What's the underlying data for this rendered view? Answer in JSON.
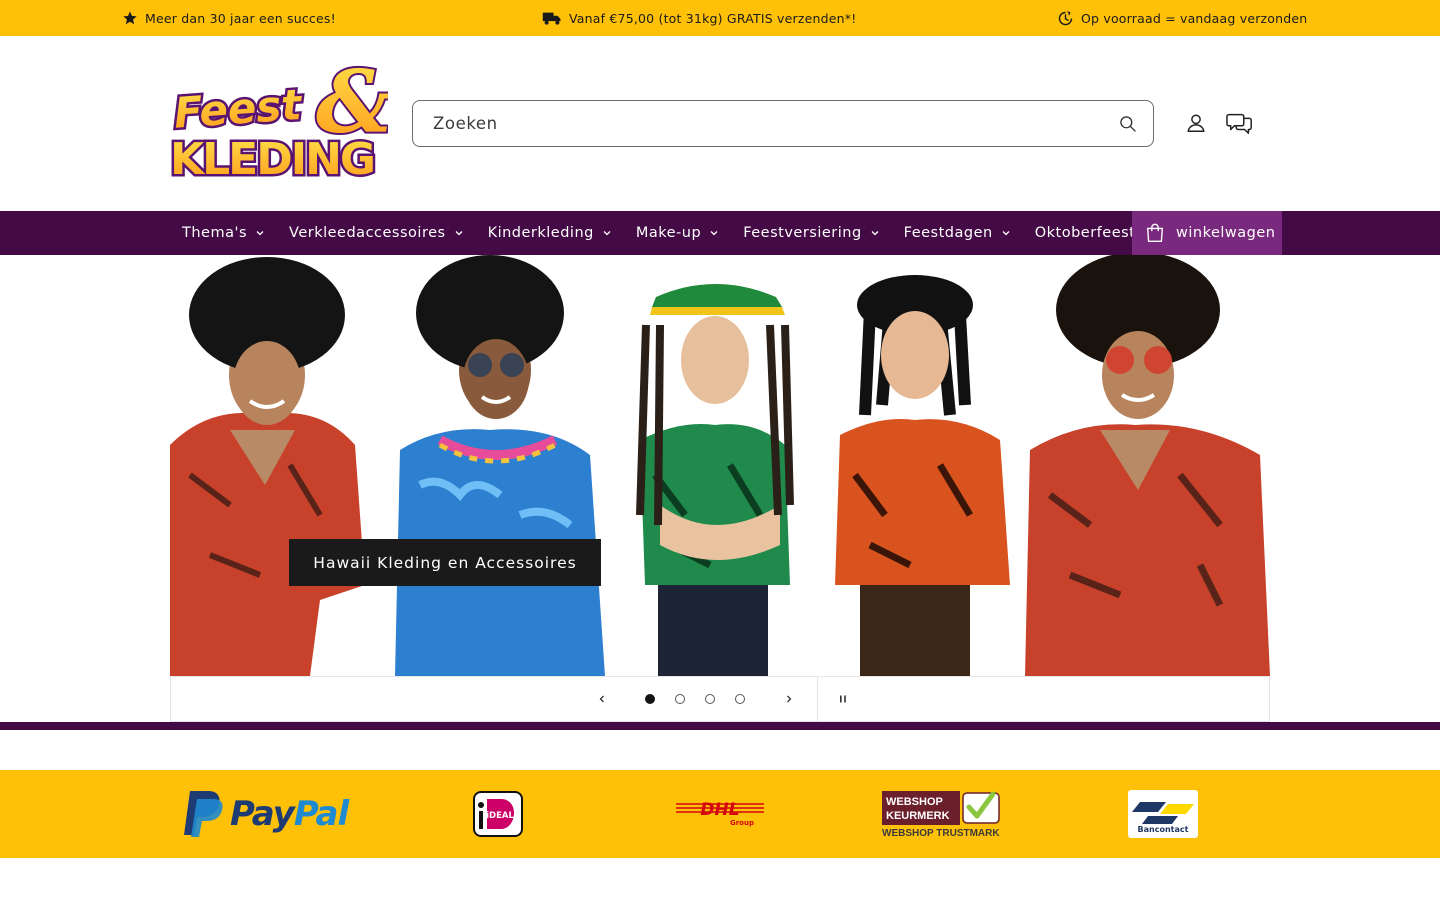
{
  "announcement": {
    "items": [
      {
        "icon": "star-icon",
        "text": "Meer dan 30 jaar een succes!"
      },
      {
        "icon": "truck-icon",
        "text": "Vanaf €75,00 (tot 31kg) GRATIS verzenden*!"
      },
      {
        "icon": "clock-icon",
        "text": "Op voorraad = vandaag verzonden"
      }
    ]
  },
  "header": {
    "logo": {
      "line1": "Feest &",
      "line2": "KLEDING"
    },
    "search": {
      "placeholder": "Zoeken"
    },
    "icons": [
      "search-icon",
      "account-icon",
      "chat-icon"
    ]
  },
  "nav": {
    "items": [
      {
        "label": "Thema's",
        "has_dropdown": true
      },
      {
        "label": "Verkleedaccessoires",
        "has_dropdown": true
      },
      {
        "label": "Kinderkleding",
        "has_dropdown": true
      },
      {
        "label": "Make-up",
        "has_dropdown": true
      },
      {
        "label": "Feestversiering",
        "has_dropdown": true
      },
      {
        "label": "Feestdagen",
        "has_dropdown": true
      },
      {
        "label": "Oktoberfeest",
        "has_dropdown": false
      }
    ],
    "cart_label": "winkelwagen"
  },
  "hero": {
    "caption": "Hawaii Kleding en Accessoires",
    "slide_count": 4,
    "active_slide": 1
  },
  "trust": {
    "paypal": {
      "pay": "Pay",
      "pal": "Pal"
    },
    "ideal": "iDEAL",
    "dhl": {
      "name": "DHL",
      "sub": "Group"
    },
    "keurmerk": {
      "line1": "WEBSHOP",
      "line2": "KEURMERK",
      "line3": "WEBSHOP TRUSTMARK"
    },
    "bancontact": "Bancontact"
  },
  "colors": {
    "announcement_bg": "#ffc107",
    "nav_bg": "#430a45",
    "cart_bg": "#7a2a7e",
    "trust_bg": "#ffc107"
  }
}
